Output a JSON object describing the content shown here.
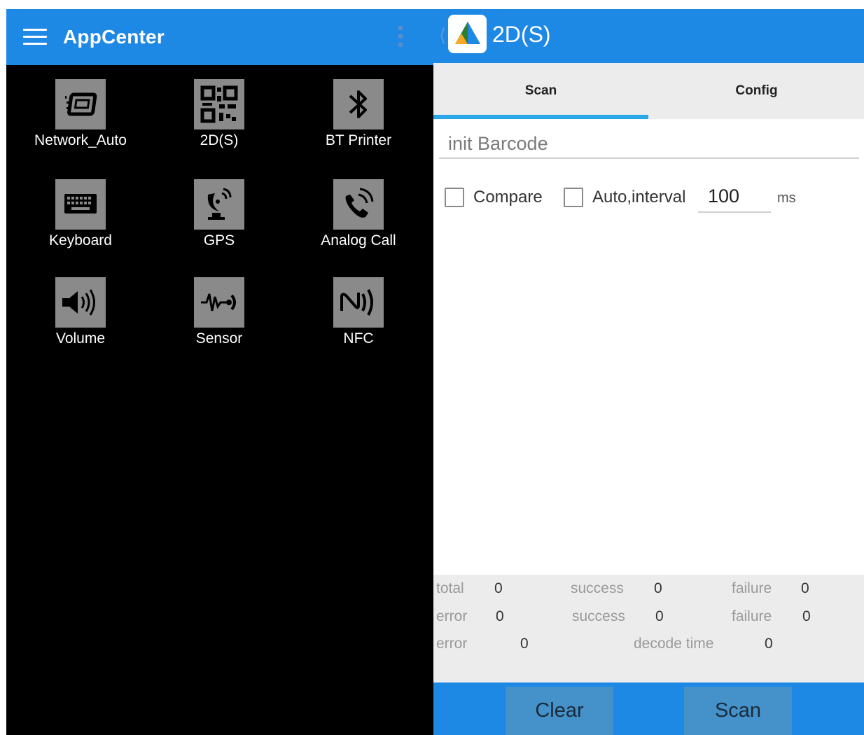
{
  "launcher": {
    "title": "AppCenter",
    "apps": [
      {
        "label": "Network_Auto",
        "icon": "network-auto-icon"
      },
      {
        "label": "2D(S)",
        "icon": "qr-code-icon"
      },
      {
        "label": "BT Printer",
        "icon": "bluetooth-icon"
      },
      {
        "label": "Keyboard",
        "icon": "keyboard-icon"
      },
      {
        "label": "GPS",
        "icon": "satellite-dish-icon"
      },
      {
        "label": "Analog Call",
        "icon": "phone-call-icon"
      },
      {
        "label": "Volume",
        "icon": "speaker-icon"
      },
      {
        "label": "Sensor",
        "icon": "sensor-wave-icon"
      },
      {
        "label": "NFC",
        "icon": "nfc-icon"
      }
    ]
  },
  "scanner": {
    "title": "2D(S)",
    "tabs": [
      {
        "label": "Scan",
        "active": true
      },
      {
        "label": "Config",
        "active": false
      }
    ],
    "barcode_field": "init Barcode",
    "compare_label": "Compare",
    "compare_checked": false,
    "auto_label": "Auto,interval",
    "auto_checked": false,
    "interval_value": "100",
    "interval_unit": "ms",
    "stats": {
      "row1": {
        "total_label": "total",
        "total": "0",
        "success_label": "success",
        "success": "0",
        "failure_label": "failure",
        "failure": "0"
      },
      "row2": {
        "error_label": "error",
        "error": "0",
        "success_label": "success",
        "success": "0",
        "failure_label": "failure",
        "failure": "0"
      },
      "row3": {
        "error_label": "error",
        "error": "0",
        "decode_label": "decode time",
        "decode": "0"
      }
    },
    "buttons": {
      "clear": "Clear",
      "scan": "Scan"
    }
  },
  "colors": {
    "app_bar": "#1e88e5",
    "tab_indicator": "#29a7e6",
    "tile_bg": "#8a8a8a",
    "button_bg": "#4591c9"
  }
}
